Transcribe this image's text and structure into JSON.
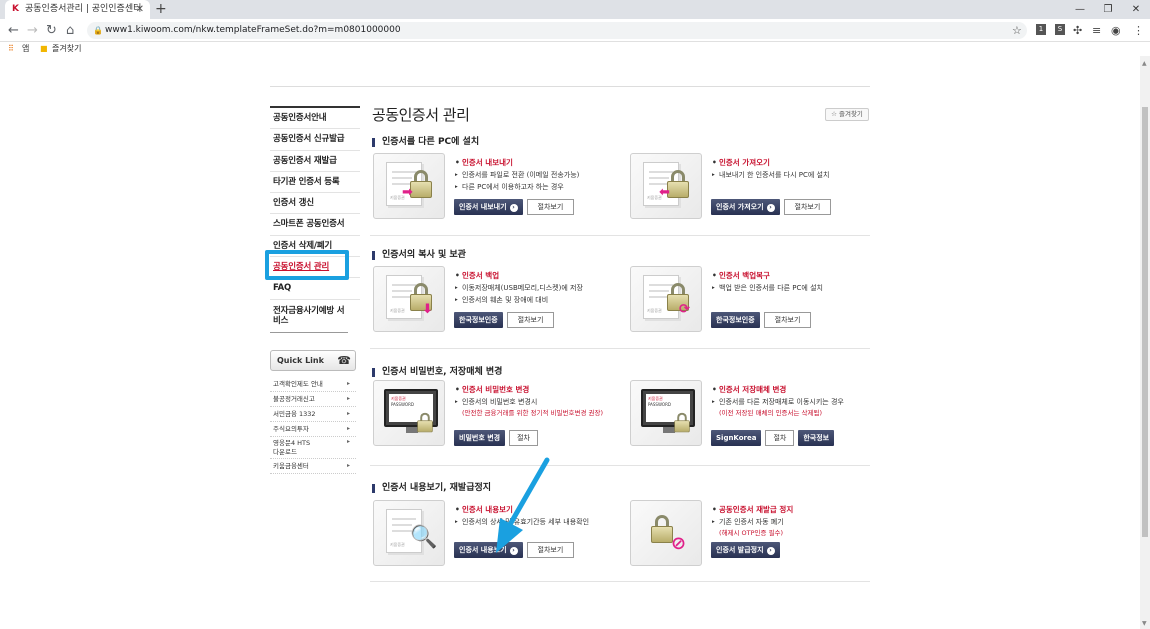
{
  "browser": {
    "tab_title": "공동인증서관리 | 공인인증센터",
    "url": "www1.kiwoom.com/nkw.templateFrameSet.do?m=m0801000000",
    "bookmarks": [
      {
        "label": "앱"
      },
      {
        "label": "즐겨찾기"
      }
    ]
  },
  "sidebar": {
    "items": [
      {
        "label": "공동인증서안내"
      },
      {
        "label": "공동인증서 신규발급"
      },
      {
        "label": "공동인증서 재발급"
      },
      {
        "label": "타기관 인증서 등록"
      },
      {
        "label": "인증서 갱신"
      },
      {
        "label": "스마트폰 공동인증서"
      },
      {
        "label": "인증서 삭제/폐기"
      },
      {
        "label": "공동인증서 관리"
      },
      {
        "label": "FAQ"
      },
      {
        "label": "전자금융사기예방 서비스"
      }
    ],
    "active_index": 7,
    "quick_link": {
      "title": "Quick Link",
      "items": [
        {
          "label": "고객확인제도 안내"
        },
        {
          "label": "불공정거래신고"
        },
        {
          "label": "서민금융 1332"
        },
        {
          "label": "주식요의투자"
        },
        {
          "label": "영웅문4 HTS 다운로드"
        },
        {
          "label": "키움금융센터"
        }
      ]
    }
  },
  "main": {
    "title": "공동인증서 관리",
    "favorite_label": "즐겨찾기",
    "sections": [
      {
        "heading": "인증서를 다른 PC에 설치",
        "cards": [
          {
            "title": "인증서 내보내기",
            "bullets": [
              "인증서를 파일로 전환 (이메일 전송가능)",
              "다른 PC에서 이용하고자 하는 경우"
            ],
            "note": "",
            "primary": "인증서 내보내기",
            "secondary": "절차보기"
          },
          {
            "title": "인증서 가져오기",
            "bullets": [
              "내보내기 한 인증서를 다시 PC에 설치"
            ],
            "note": "",
            "primary": "인증서 가져오기",
            "secondary": "절차보기"
          }
        ]
      },
      {
        "heading": "인증서의 복사 및 보관",
        "cards": [
          {
            "title": "인증서 백업",
            "bullets": [
              "이동저장매체(USB메모리,디스켓)에 저장",
              "인증서의 훼손 및 장애에 대비"
            ],
            "note": "",
            "primary": "한국정보인증",
            "secondary": "절차보기"
          },
          {
            "title": "인증서 백업복구",
            "bullets": [
              "백업 받은 인증서를 다른 PC에 설치"
            ],
            "note": "",
            "primary": "한국정보인증",
            "secondary": "절차보기"
          }
        ]
      },
      {
        "heading": "인증서 비밀번호, 저장매체 변경",
        "cards": [
          {
            "title": "인증서 비밀번호 변경",
            "bullets": [
              "인증서의 비밀번호 변경시"
            ],
            "note": "(안전한 금융거래를 위한 정기적 비밀번호변경 권장)",
            "primary": "비밀번호 변경",
            "secondary": "절차"
          },
          {
            "title": "인증서 저장매체 변경",
            "bullets": [
              "인증서를 다른 저장매체로 이동시키는 경우"
            ],
            "note": "(이전 저장된 매체의 인증서는 삭제됨)",
            "primary": "SignKorea",
            "secondary": "절차",
            "tertiary": "한국정보"
          }
        ]
      },
      {
        "heading": "인증서 내용보기, 재발급정지",
        "cards": [
          {
            "title": "인증서 내용보기",
            "bullets": [
              "인증서의 상세 및 유효기간등 세부 내용확인"
            ],
            "note": "",
            "primary": "인증서 내용보기",
            "secondary": "절차보기"
          },
          {
            "title": "공동인증서 재발급 정지",
            "bullets": [
              "기존 인증서 자동 폐기"
            ],
            "note": "(해제시 OTP인증 필수)",
            "primary": "인증서 발급정지",
            "secondary": ""
          }
        ]
      }
    ],
    "image_badges": {
      "doc": "키움증권",
      "monitor_brand": "키움증권",
      "monitor_label": "PASSWORD"
    }
  },
  "colors": {
    "accent_red": "#c8102e",
    "highlight_blue": "#1aa0e0",
    "button_navy": "#283152"
  }
}
